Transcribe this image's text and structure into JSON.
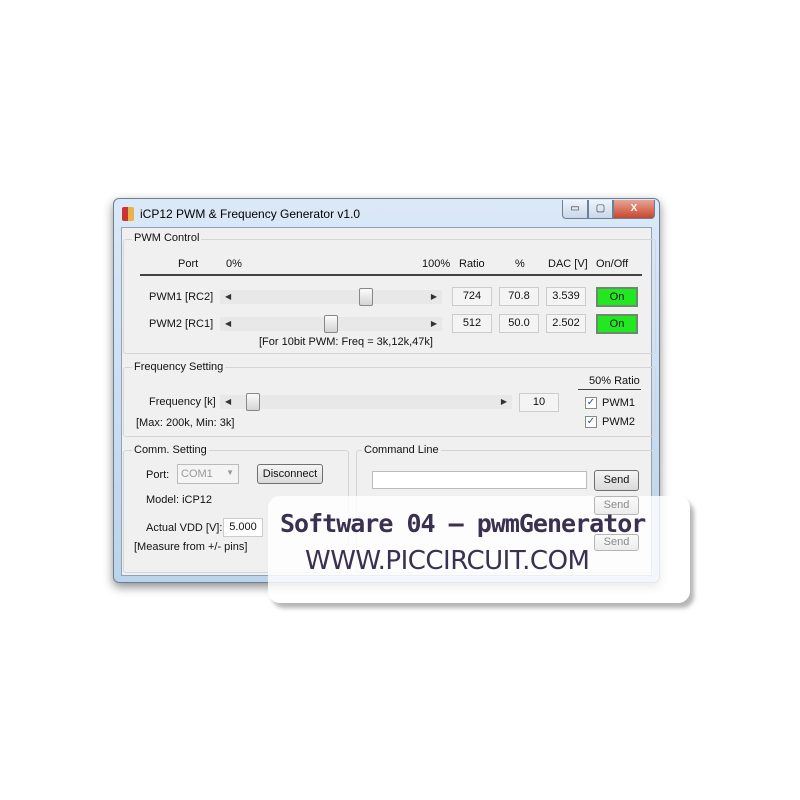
{
  "window": {
    "title": "iCP12 PWM & Frequency Generator v1.0",
    "minimize": "▭",
    "maximize": "▢",
    "close": "X"
  },
  "pwm": {
    "group": "PWM Control",
    "headers": {
      "port": "Port",
      "min": "0%",
      "max": "100%",
      "ratio": "Ratio",
      "percent": "%",
      "dac": "DAC [V]",
      "onoff": "On/Off"
    },
    "rows": [
      {
        "port": "PWM1 [RC2]",
        "slider_percent": 70.8,
        "ratio": "724",
        "percent": "70.8",
        "dac": "3.539",
        "state": "On"
      },
      {
        "port": "PWM2 [RC1]",
        "slider_percent": 50.0,
        "ratio": "512",
        "percent": "50.0",
        "dac": "2.502",
        "state": "On"
      }
    ],
    "note": "[For 10bit PWM: Freq = 3k,12k,47k]"
  },
  "freq": {
    "group": "Frequency Setting",
    "label": "Frequency [k]",
    "value": "10",
    "range_note": "[Max: 200k, Min: 3k]",
    "ratio_header": "50% Ratio",
    "checks": [
      {
        "label": "PWM1",
        "checked": true
      },
      {
        "label": "PWM2",
        "checked": true
      }
    ]
  },
  "comm": {
    "group": "Comm. Setting",
    "port_label": "Port:",
    "port_value": "COM1",
    "disconnect": "Disconnect",
    "model": "Model: iCP12",
    "vdd_label": "Actual VDD [V]:",
    "vdd_value": "5.000",
    "measure_note": "[Measure from +/- pins]"
  },
  "cmd": {
    "group": "Command Line",
    "send": "Send",
    "send2": "Send",
    "send3": "Send",
    "input_value": ""
  },
  "overlay": {
    "line1": "Software 04 – pwmGenerator",
    "line2": "WWW.PICCIRCUIT.COM"
  },
  "colors": {
    "on_button": "#22e822",
    "overlay_text": "#3a3050"
  }
}
